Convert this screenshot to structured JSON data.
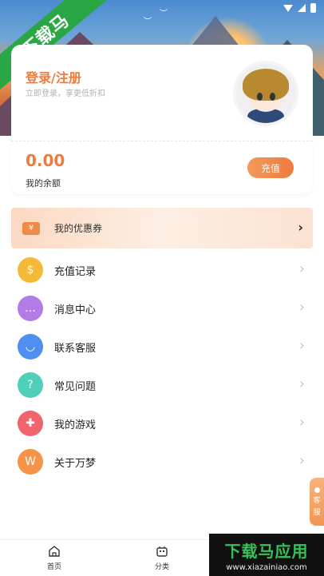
{
  "watermark": {
    "ribbon": "下载马",
    "main": "下载马应用",
    "url": "www.xiazainiao.com"
  },
  "profile": {
    "login_title": "登录/注册",
    "login_subtitle": "立即登录，享更低折扣"
  },
  "balance": {
    "value": "0.00",
    "label": "我的余额",
    "recharge_label": "充值"
  },
  "coupon": {
    "label": "我的优惠券",
    "icon": "¥"
  },
  "menu": [
    {
      "label": "充值记录",
      "icon": "money-bag-icon",
      "color": "#f5b93a"
    },
    {
      "label": "消息中心",
      "icon": "message-icon",
      "color": "#b27be8"
    },
    {
      "label": "联系客服",
      "icon": "headset-icon",
      "color": "#4e8ff0"
    },
    {
      "label": "常见问题",
      "icon": "question-icon",
      "color": "#4fcfb8"
    },
    {
      "label": "我的游戏",
      "icon": "gamepad-icon",
      "color": "#f0646e"
    },
    {
      "label": "关于万梦",
      "icon": "wanmeng-logo-icon",
      "color": "#f59348"
    }
  ],
  "side_service": {
    "line1": "客",
    "line2": "服"
  },
  "bottom_nav": [
    {
      "label": "首页",
      "icon": "home-icon"
    },
    {
      "label": "分类",
      "icon": "category-icon"
    }
  ]
}
